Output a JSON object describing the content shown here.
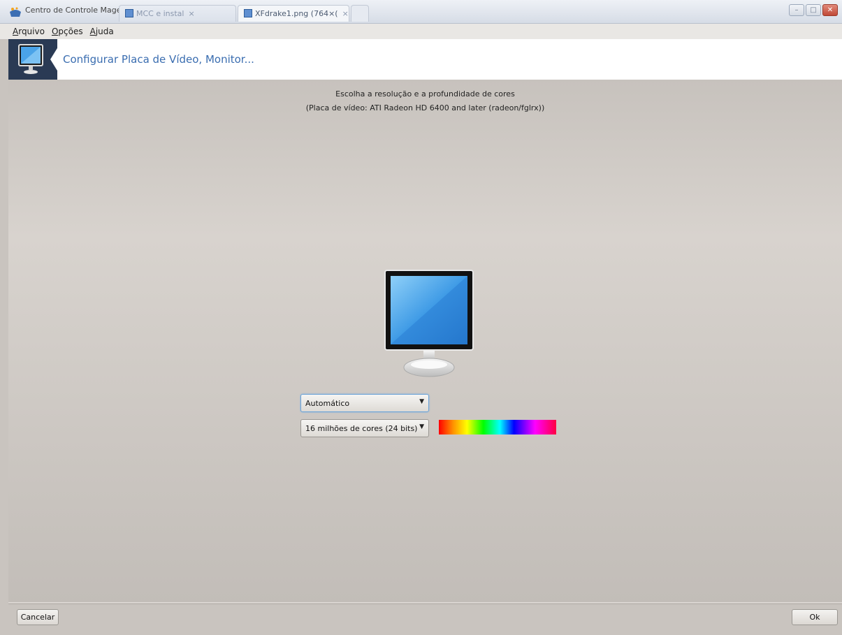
{
  "window": {
    "title": "Centro de Controle Mageia [em localhost]",
    "tabs": [
      {
        "label": "MCC e instal",
        "close": "×"
      },
      {
        "label": "XFdrake1.png (764×(",
        "close": "×"
      }
    ],
    "controls": {
      "minimize": "–",
      "maximize": "□",
      "close": "✕"
    }
  },
  "menubar": {
    "items": [
      {
        "mnemonic": "A",
        "rest": "rquivo"
      },
      {
        "mnemonic": "O",
        "rest": "pções"
      },
      {
        "mnemonic": "A",
        "rest": "juda"
      }
    ]
  },
  "header": {
    "title": "Configurar Placa de Vídeo, Monitor..."
  },
  "main": {
    "subtitle_line1": "Escolha a resolução e a profundidade de cores",
    "subtitle_line2": "(Placa de vídeo: ATI Radeon HD 6400 and later (radeon/fglrx))",
    "resolution": {
      "selected": "Automático"
    },
    "color_depth": {
      "selected": "16 milhões de cores (24 bits)"
    },
    "icons": {
      "monitor": "monitor-icon",
      "color_preview": "color-spectrum"
    }
  },
  "footer": {
    "cancel_label": "Cancelar",
    "ok_label": "Ok"
  },
  "colors": {
    "header_accent": "#3a6db0",
    "header_icon_bg": "#2a3a54",
    "focus_ring": "#6ba2d6"
  }
}
